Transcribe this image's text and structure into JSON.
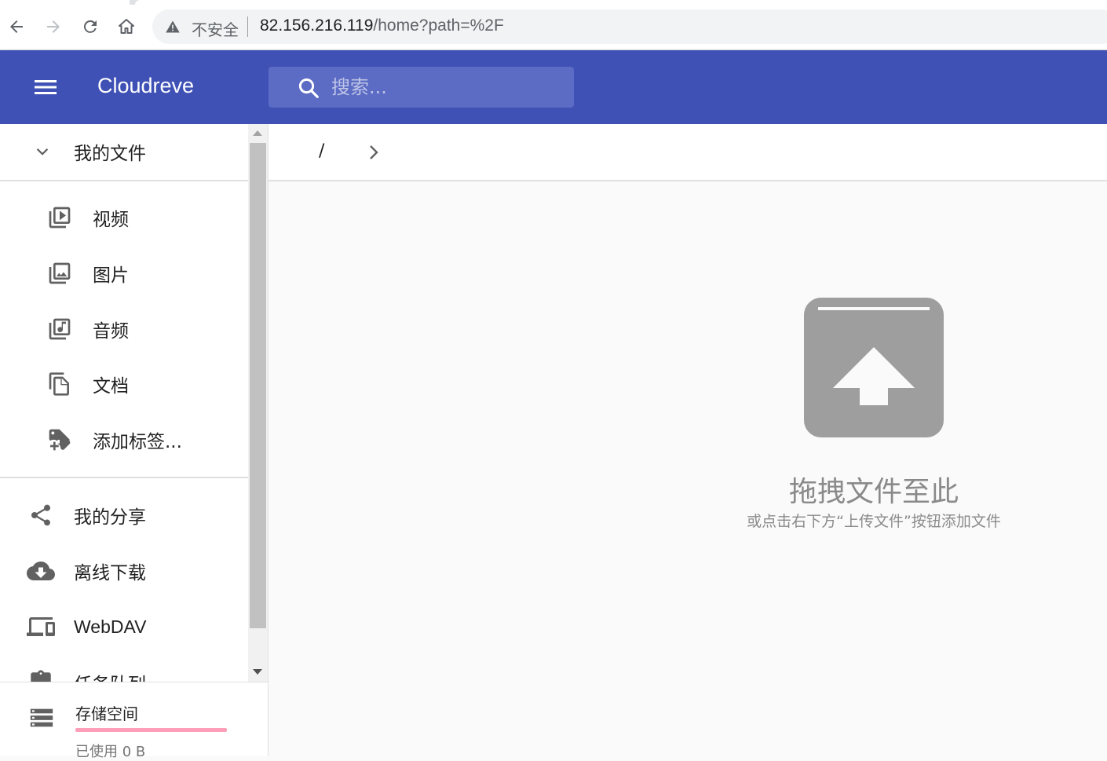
{
  "browser": {
    "security_label": "不安全",
    "url_host": "82.156.216.119",
    "url_path": "/home?path=%2F"
  },
  "appbar": {
    "title": "Cloudreve",
    "search_placeholder": "搜索..."
  },
  "sidebar": {
    "my_files": "我的文件",
    "categories": [
      {
        "label": "视频",
        "icon": "video-library-icon"
      },
      {
        "label": "图片",
        "icon": "photo-library-icon"
      },
      {
        "label": "音频",
        "icon": "music-library-icon"
      },
      {
        "label": "文档",
        "icon": "document-copy-icon"
      },
      {
        "label": "添加标签...",
        "icon": "add-tag-icon"
      }
    ],
    "items": [
      {
        "label": "我的分享",
        "icon": "share-icon"
      },
      {
        "label": "离线下载",
        "icon": "cloud-download-icon"
      },
      {
        "label": "WebDAV",
        "icon": "devices-icon"
      },
      {
        "label": "任务队列",
        "icon": "clipboard-icon"
      }
    ],
    "storage": {
      "label": "存储空间",
      "used_label": "已使用",
      "used_value": "0 B",
      "usage_fraction": 0
    }
  },
  "breadcrumb": {
    "root": "/"
  },
  "empty_state": {
    "title": "拖拽文件至此",
    "subtitle": "或点击右下方“上传文件”按钮添加文件"
  },
  "colors": {
    "primary": "#3f51b5",
    "search_bg": "#5c6bc4",
    "storage_bar": "#ff9eb8",
    "empty_icon": "#9e9e9e"
  }
}
